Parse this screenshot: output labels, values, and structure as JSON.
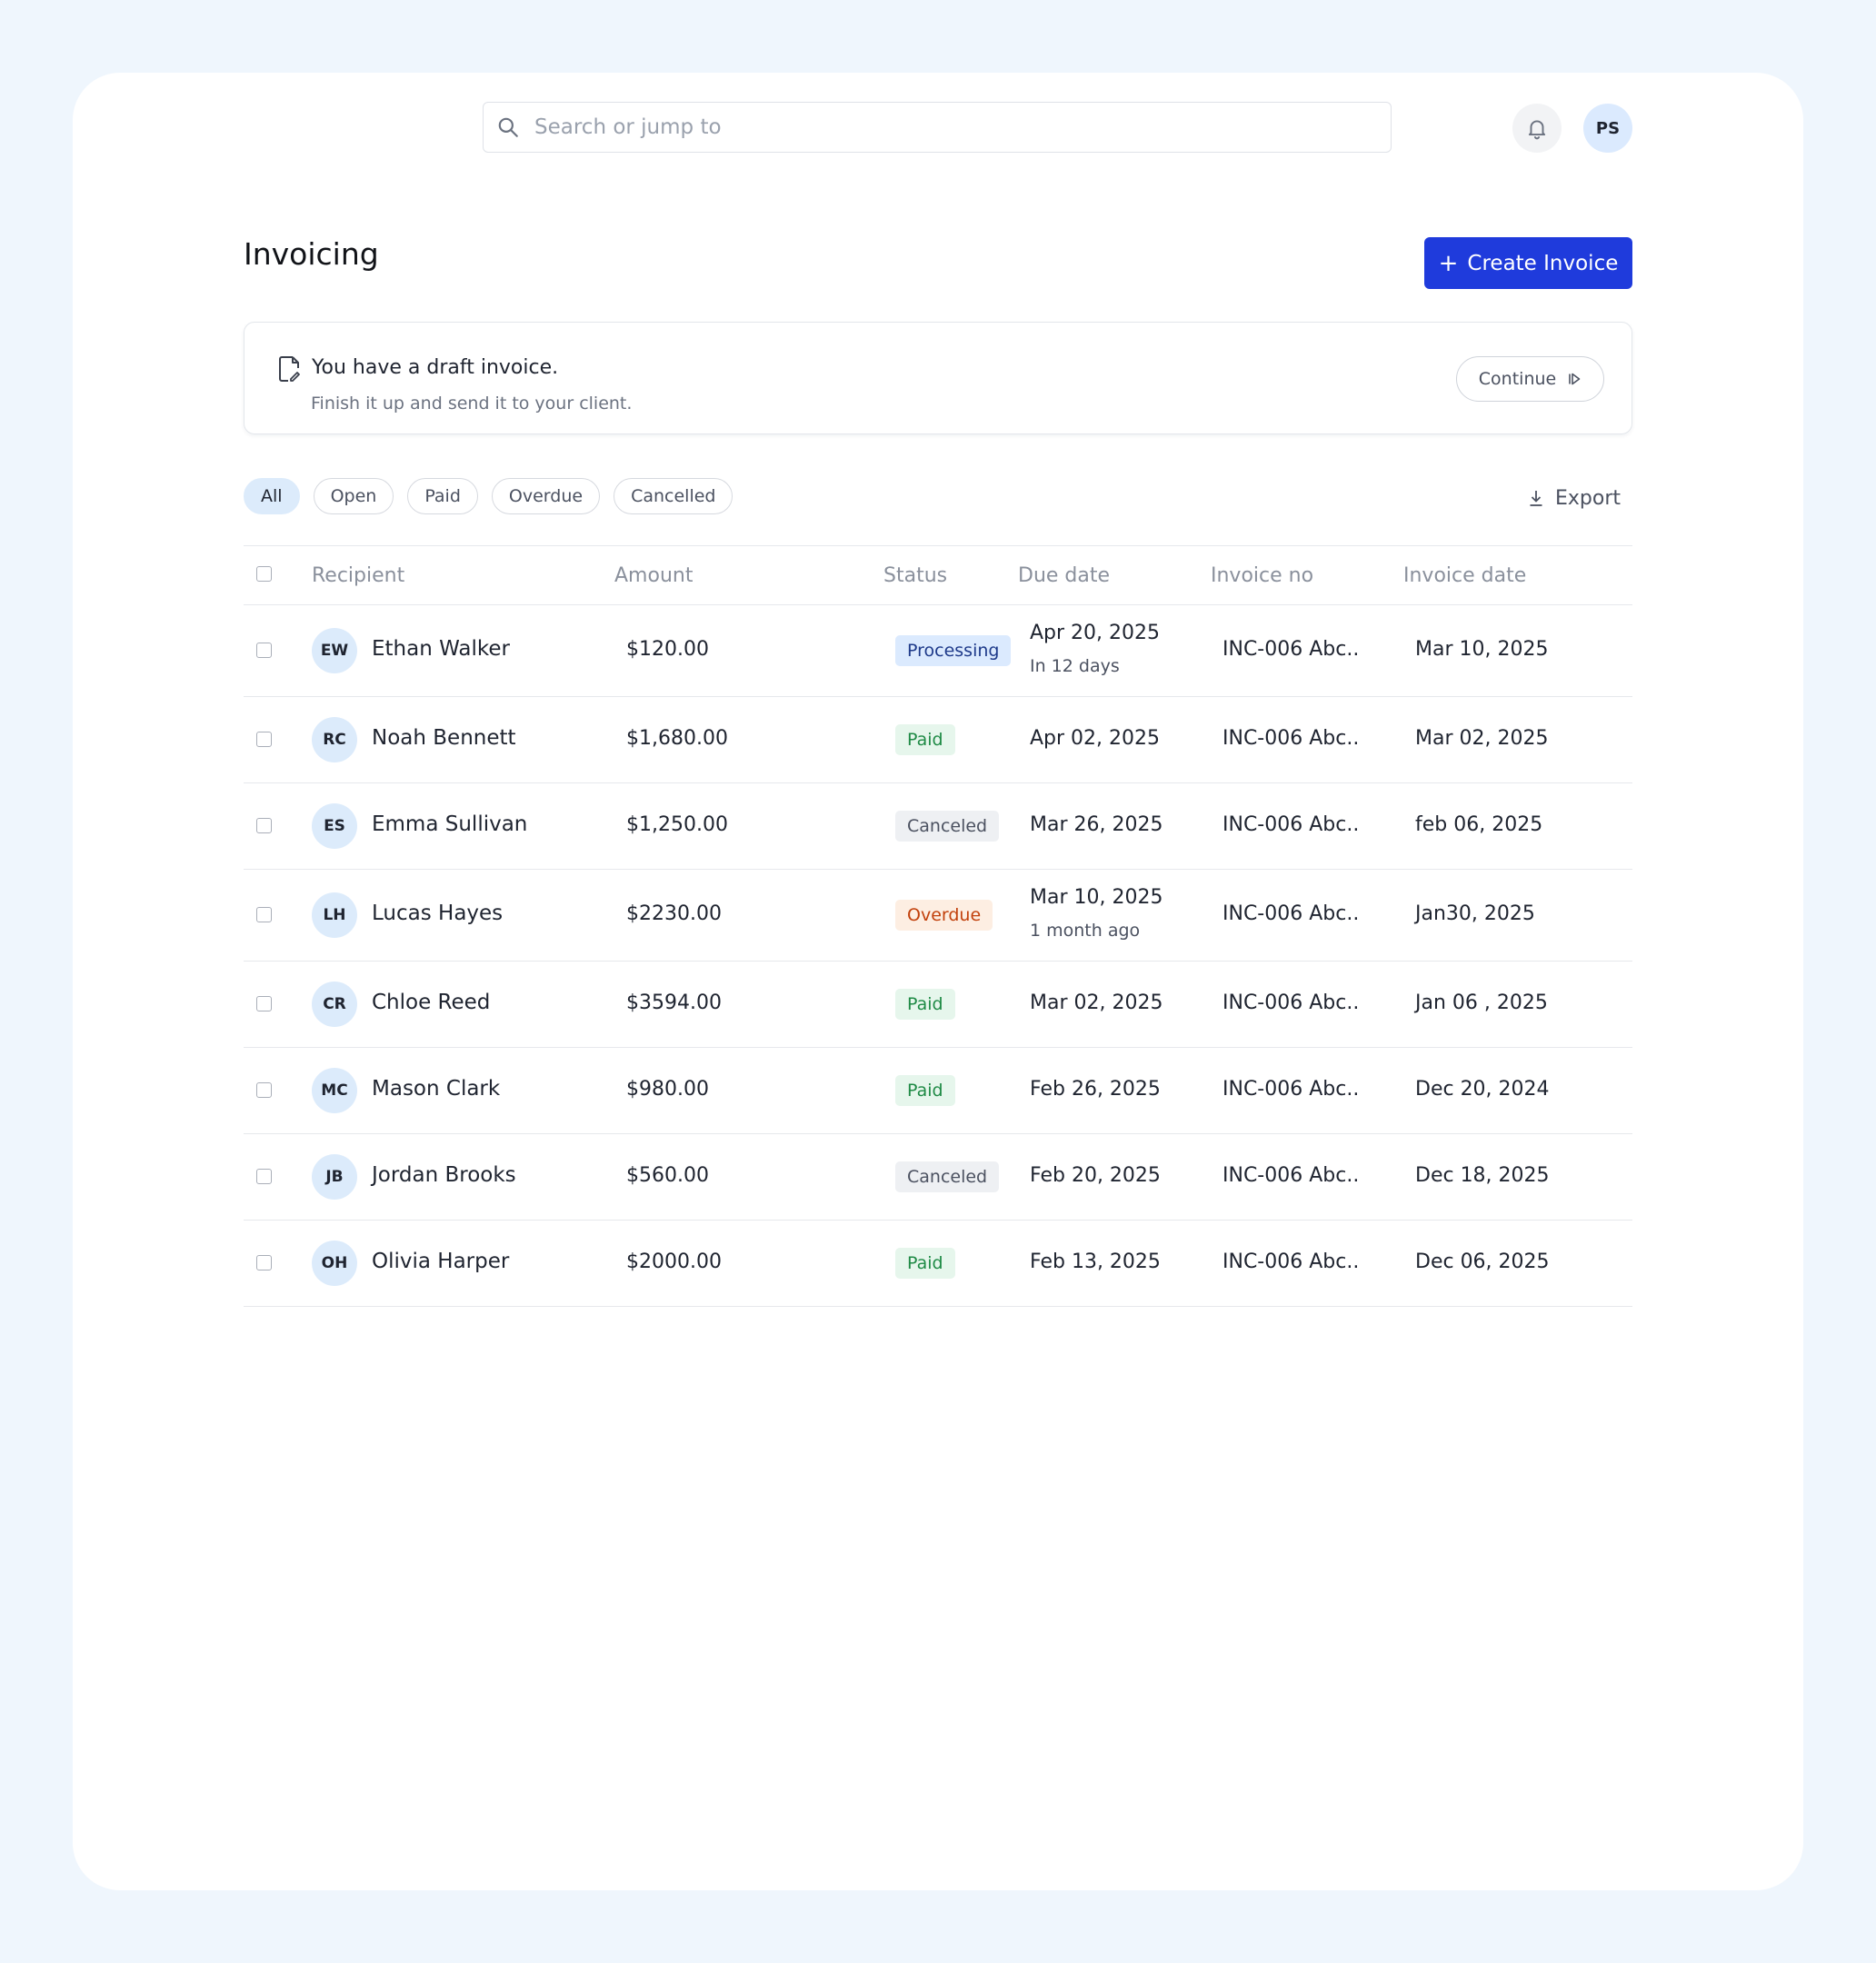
{
  "search": {
    "placeholder": "Search or jump to"
  },
  "user": {
    "initials": "PS"
  },
  "header": {
    "title": "Invoicing",
    "create_label": "Create Invoice",
    "create_icon": "plus-icon"
  },
  "draft": {
    "title": "You have a draft invoice.",
    "subtitle": "Finish it up and send it to your client.",
    "continue_label": "Continue"
  },
  "filters": [
    "All",
    "Open",
    "Paid",
    "Overdue",
    "Cancelled"
  ],
  "active_filter": "All",
  "export_label": "Export",
  "table": {
    "columns": [
      "Recipient",
      "Amount",
      "Status",
      "Due date",
      "Invoice no",
      "Invoice date"
    ],
    "rows": [
      {
        "initials": "EW",
        "name": "Ethan Walker",
        "amount": "$120.00",
        "status": "Processing",
        "status_type": "processing",
        "due": "Apr 20, 2025",
        "due_sub": "In 12 days",
        "invoice_no": "INC-006 Abc..",
        "invoice_date": "Mar 10, 2025"
      },
      {
        "initials": "RC",
        "name": "Noah Bennett",
        "amount": "$1,680.00",
        "status": "Paid",
        "status_type": "paid",
        "due": "Apr 02, 2025",
        "due_sub": "",
        "invoice_no": "INC-006 Abc..",
        "invoice_date": "Mar 02, 2025"
      },
      {
        "initials": "ES",
        "name": "Emma Sullivan",
        "amount": "$1,250.00",
        "status": "Canceled",
        "status_type": "canceled",
        "due": "Mar 26, 2025",
        "due_sub": "",
        "invoice_no": "INC-006 Abc..",
        "invoice_date": "feb 06, 2025"
      },
      {
        "initials": "LH",
        "name": "Lucas Hayes",
        "amount": "$2230.00",
        "status": "Overdue",
        "status_type": "overdue",
        "due": "Mar 10, 2025",
        "due_sub": "1 month ago",
        "invoice_no": "INC-006 Abc..",
        "invoice_date": "Jan30, 2025"
      },
      {
        "initials": "CR",
        "name": "Chloe Reed",
        "amount": "$3594.00",
        "status": "Paid",
        "status_type": "paid",
        "due": "Mar 02, 2025",
        "due_sub": "",
        "invoice_no": "INC-006 Abc..",
        "invoice_date": "Jan 06 , 2025"
      },
      {
        "initials": "MC",
        "name": "Mason Clark",
        "amount": "$980.00",
        "status": "Paid",
        "status_type": "paid",
        "due": "Feb 26, 2025",
        "due_sub": "",
        "invoice_no": "INC-006 Abc..",
        "invoice_date": "Dec 20, 2024"
      },
      {
        "initials": "JB",
        "name": "Jordan Brooks",
        "amount": "$560.00",
        "status": "Canceled",
        "status_type": "canceled",
        "due": "Feb 20, 2025",
        "due_sub": "",
        "invoice_no": "INC-006 Abc..",
        "invoice_date": "Dec 18, 2025"
      },
      {
        "initials": "OH",
        "name": "Olivia Harper",
        "amount": "$2000.00",
        "status": "Paid",
        "status_type": "paid",
        "due": "Feb 13, 2025",
        "due_sub": "",
        "invoice_no": "INC-006 Abc..",
        "invoice_date": "Dec 06, 2025"
      }
    ]
  },
  "colors": {
    "background": "#eff6fd",
    "primary": "#1f3bdc",
    "avatar": "#dcebfb",
    "processing": "#1e3a8a",
    "paid": "#1e8a45",
    "overdue": "#c2410c"
  }
}
